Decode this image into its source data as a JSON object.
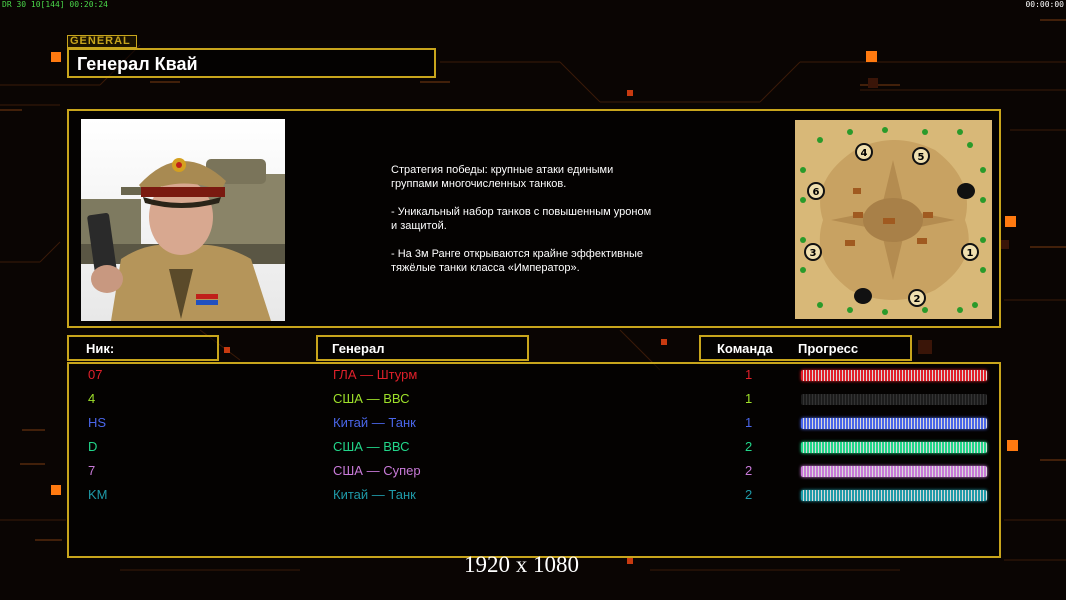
{
  "overlay": {
    "fps": "DR 30 10[144] 00:20:24",
    "clock": "00:00:00"
  },
  "header": {
    "tag": "GENERAL",
    "title": "Генерал Квай"
  },
  "description": "Стратегия победы: крупные атаки едиными\n группами многочисленных танков.\n\n- Уникальный набор танков с повышенным уроном\n и защитой.\n\n- На 3м Ранге открываются крайне эффективные\n тяжёлые танки класса «Император».",
  "map": {
    "positions": [
      "1",
      "2",
      "3",
      "4",
      "5",
      "6"
    ]
  },
  "columns": {
    "nick": "Ник:",
    "general": "Генерал",
    "team": "Команда",
    "progress": "Прогресс"
  },
  "players": [
    {
      "nick": "07",
      "general": "ГЛА — Штурм",
      "team": "1",
      "color": "#e0202a",
      "progress": 1.0
    },
    {
      "nick": "4",
      "general": "США — ВВС",
      "team": "1",
      "color": "#9ee02a",
      "progress": 0.0
    },
    {
      "nick": "HS",
      "general": "Китай — Танк",
      "team": "1",
      "color": "#4a66e8",
      "progress": 1.0
    },
    {
      "nick": "D",
      "general": "США — ВВС",
      "team": "2",
      "color": "#22d68a",
      "progress": 1.0
    },
    {
      "nick": "7",
      "general": "США — Супер",
      "team": "2",
      "color": "#c87ad8",
      "progress": 1.0
    },
    {
      "nick": "KM",
      "general": "Китай — Танк",
      "team": "2",
      "color": "#1f9aa8",
      "progress": 1.0
    }
  ],
  "caption": "1920 x 1080"
}
